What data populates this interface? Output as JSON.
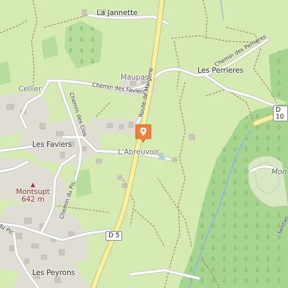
{
  "places": {
    "la_jannette": "La Jannette",
    "maupas": "Maupas",
    "les_perrieres": "Les Perrieres",
    "cellier": "Cellier",
    "les_faviers": "Les Faviers",
    "labreuvoir": "L'Abreuvoir",
    "les_peyrons": "Les Peyrons",
    "mont_partial": "Mon"
  },
  "summit": {
    "name": "Montsupt",
    "elevation": "642 m"
  },
  "roads": {
    "chemin_des_faviers": "Chemin des Faviers",
    "chemin_des_perrieres": "Chemin des Perrieres",
    "chemin_des_clos": "Chemin des Clos",
    "chemin_du_pic": "Chemin du Pic",
    "route_de_margerie": "Route de Margerie",
    "du_pic_partial": "du Pic",
    "sentier_partial": "Sentier"
  },
  "shields": {
    "d5": "D 5",
    "d10": "D 10"
  },
  "marker": {
    "icon": "map-pin-icon",
    "color": "#f0803c"
  },
  "colors": {
    "meadow": "#d6ebb4",
    "forest": "#a7d58f",
    "residential": "#e0ddd5",
    "main_road": "#f5f1a0"
  }
}
